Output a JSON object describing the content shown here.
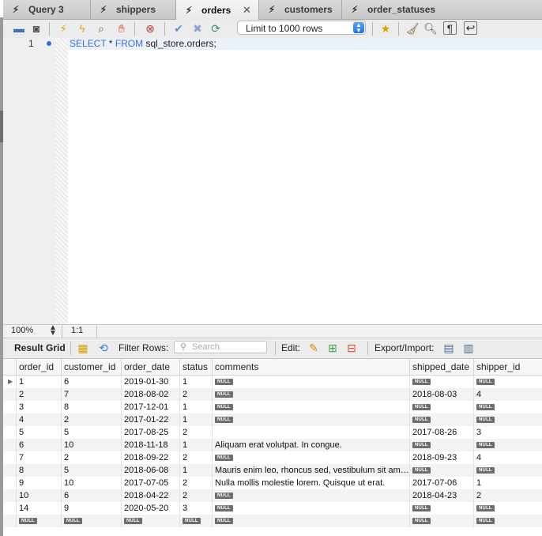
{
  "tabs": [
    {
      "label": "Query 3",
      "active": false
    },
    {
      "label": "shippers",
      "active": false
    },
    {
      "label": "orders",
      "active": true
    },
    {
      "label": "customers",
      "active": false
    },
    {
      "label": "order_statuses",
      "active": false
    }
  ],
  "toolbar": {
    "limit_label": "Limit to 1000 rows",
    "icons": [
      "open-folder-icon",
      "save-icon",
      "execute-icon",
      "execute-statement-icon",
      "explain-icon",
      "stop-icon",
      "toggle-continue-on-error-icon",
      "commit-icon",
      "rollback-icon",
      "autocommit-icon",
      "beautify-star-icon",
      "broom-icon",
      "find-icon",
      "invisible-chars-icon",
      "wrap-icon"
    ]
  },
  "editor": {
    "line_number": "1",
    "code_kw1": "SELECT",
    "code_mid": " * ",
    "code_kw2": "FROM",
    "code_rest": " sql_store.orders;"
  },
  "status": {
    "zoom": "100%",
    "cursor": "1:1"
  },
  "result_bar": {
    "title": "Result Grid",
    "filter_label": "Filter Rows:",
    "search_placeholder": "Search",
    "edit_label": "Edit:",
    "export_label": "Export/Import:"
  },
  "grid": {
    "columns": [
      "order_id",
      "customer_id",
      "order_date",
      "status",
      "comments",
      "shipped_date",
      "shipper_id"
    ],
    "null_text": "NULL",
    "rows": [
      [
        "1",
        "6",
        "2019-01-30",
        "1",
        null,
        null,
        null
      ],
      [
        "2",
        "7",
        "2018-08-02",
        "2",
        null,
        "2018-08-03",
        "4"
      ],
      [
        "3",
        "8",
        "2017-12-01",
        "1",
        null,
        null,
        null
      ],
      [
        "4",
        "2",
        "2017-01-22",
        "1",
        null,
        null,
        null
      ],
      [
        "5",
        "5",
        "2017-08-25",
        "2",
        "",
        "2017-08-26",
        "3"
      ],
      [
        "6",
        "10",
        "2018-11-18",
        "1",
        "Aliquam erat volutpat. In congue.",
        null,
        null
      ],
      [
        "7",
        "2",
        "2018-09-22",
        "2",
        null,
        "2018-09-23",
        "4"
      ],
      [
        "8",
        "5",
        "2018-06-08",
        "1",
        "Mauris enim leo, rhoncus sed, vestibulum sit am…",
        null,
        null
      ],
      [
        "9",
        "10",
        "2017-07-05",
        "2",
        "Nulla mollis molestie lorem. Quisque ut erat.",
        "2017-07-06",
        "1"
      ],
      [
        "10",
        "6",
        "2018-04-22",
        "2",
        null,
        "2018-04-23",
        "2"
      ],
      [
        "14",
        "9",
        "2020-05-20",
        "3",
        null,
        null,
        null
      ],
      [
        null,
        null,
        null,
        null,
        null,
        null,
        null
      ]
    ]
  }
}
